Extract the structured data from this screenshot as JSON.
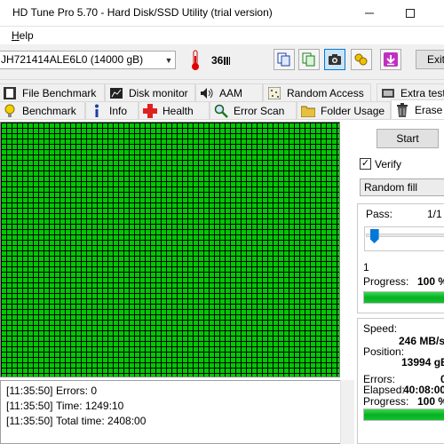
{
  "window": {
    "title": "HD Tune Pro 5.70 - Hard Disk/SSD Utility (trial version)"
  },
  "menu": {
    "help_label": "Help"
  },
  "toolbar": {
    "drive": "JH721414ALE6L0 (14000 gB)",
    "temperature": "36",
    "exit_label": "Exit",
    "buttons": [
      "copy-info-icon",
      "copy-results-icon",
      "screenshot-icon",
      "options-icon",
      "download-icon"
    ]
  },
  "tabs": {
    "row1": [
      "File Benchmark",
      "Disk monitor",
      "AAM",
      "Random Access",
      "Extra tests"
    ],
    "row2": [
      "Benchmark",
      "Info",
      "Health",
      "Error Scan",
      "Folder Usage",
      "Erase"
    ],
    "active": "Erase"
  },
  "erase": {
    "start_label": "Start",
    "verify_label": "Verify",
    "verify_checked": true,
    "fill_mode": "Random fill",
    "pass_label": "Pass:",
    "pass_value": "1/1",
    "slider_min": "1",
    "slider_level": 0.05,
    "progress_label": "Progress:",
    "pass_progress": "100 %",
    "pass_progress_fraction": 1.0,
    "speed_label": "Speed:",
    "speed_value": "246 MB/s",
    "position_label": "Position:",
    "position_value": "13994 gB",
    "errors_label": "Errors:",
    "errors_value": "0",
    "elapsed_label": "Elapsed:",
    "elapsed_value": "40:08:00",
    "total_progress": "100 %",
    "total_progress_fraction": 1.0
  },
  "block_map": {
    "block_color": "#00c800",
    "grid_color": "#000000",
    "status": "all blocks ok"
  },
  "log": [
    {
      "time": "[11:35:50]",
      "text": "Errors: 0"
    },
    {
      "time": "[11:35:50]",
      "text": "Time: 1249:10"
    },
    {
      "time": "[11:35:50]",
      "text": "Total time: 2408:00"
    }
  ]
}
